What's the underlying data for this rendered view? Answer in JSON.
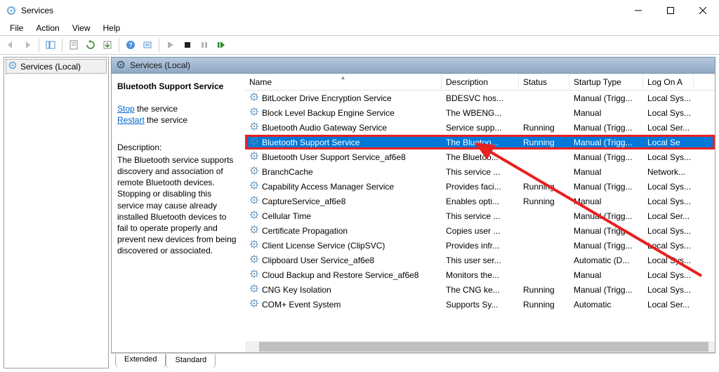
{
  "window": {
    "title": "Services"
  },
  "menubar": [
    "File",
    "Action",
    "View",
    "Help"
  ],
  "tree": {
    "root": "Services (Local)"
  },
  "content_header": "Services (Local)",
  "detail": {
    "service_name": "Bluetooth Support Service",
    "stop_link": "Stop",
    "stop_suffix": " the service",
    "restart_link": "Restart",
    "restart_suffix": " the service",
    "description_label": "Description:",
    "description_text": "The Bluetooth service supports discovery and association of remote Bluetooth devices. Stopping or disabling this service may cause already installed Bluetooth devices to fail to operate properly and prevent new devices from being discovered or associated."
  },
  "columns": {
    "name": "Name",
    "description": "Description",
    "status": "Status",
    "startup": "Startup Type",
    "logon": "Log On A"
  },
  "rows": [
    {
      "name": "BitLocker Drive Encryption Service",
      "desc": "BDESVC hos...",
      "status": "",
      "startup": "Manual (Trigg...",
      "logon": "Local Sys..."
    },
    {
      "name": "Block Level Backup Engine Service",
      "desc": "The WBENG...",
      "status": "",
      "startup": "Manual",
      "logon": "Local Sys..."
    },
    {
      "name": "Bluetooth Audio Gateway Service",
      "desc": "Service supp...",
      "status": "Running",
      "startup": "Manual (Trigg...",
      "logon": "Local Ser..."
    },
    {
      "name": "Bluetooth Support Service",
      "desc": "The Bluetoo...",
      "status": "Running",
      "startup": "Manual (Trigg...",
      "logon": "Local Se",
      "selected": true,
      "highlighted": true
    },
    {
      "name": "Bluetooth User Support Service_af6e8",
      "desc": "The Bluetoo...",
      "status": "",
      "startup": "Manual (Trigg...",
      "logon": "Local Sys..."
    },
    {
      "name": "BranchCache",
      "desc": "This service ...",
      "status": "",
      "startup": "Manual",
      "logon": "Network..."
    },
    {
      "name": "Capability Access Manager Service",
      "desc": "Provides faci...",
      "status": "Running",
      "startup": "Manual (Trigg...",
      "logon": "Local Sys..."
    },
    {
      "name": "CaptureService_af6e8",
      "desc": "Enables opti...",
      "status": "Running",
      "startup": "Manual",
      "logon": "Local Sys..."
    },
    {
      "name": "Cellular Time",
      "desc": "This service ...",
      "status": "",
      "startup": "Manual (Trigg...",
      "logon": "Local Ser..."
    },
    {
      "name": "Certificate Propagation",
      "desc": "Copies user ...",
      "status": "",
      "startup": "Manual (Trigg...",
      "logon": "Local Sys..."
    },
    {
      "name": "Client License Service (ClipSVC)",
      "desc": "Provides infr...",
      "status": "",
      "startup": "Manual (Trigg...",
      "logon": "Local Sys..."
    },
    {
      "name": "Clipboard User Service_af6e8",
      "desc": "This user ser...",
      "status": "",
      "startup": "Automatic (D...",
      "logon": "Local Sys..."
    },
    {
      "name": "Cloud Backup and Restore Service_af6e8",
      "desc": "Monitors the...",
      "status": "",
      "startup": "Manual",
      "logon": "Local Sys..."
    },
    {
      "name": "CNG Key Isolation",
      "desc": "The CNG ke...",
      "status": "Running",
      "startup": "Manual (Trigg...",
      "logon": "Local Sys..."
    },
    {
      "name": "COM+ Event System",
      "desc": "Supports Sy...",
      "status": "Running",
      "startup": "Automatic",
      "logon": "Local Ser..."
    }
  ],
  "tabs": {
    "extended": "Extended",
    "standard": "Standard"
  }
}
